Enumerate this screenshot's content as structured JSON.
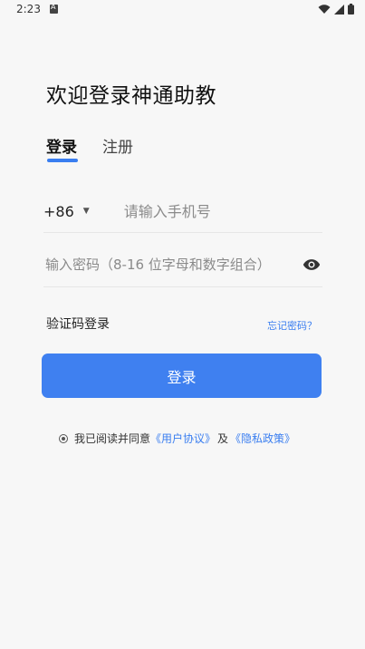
{
  "status_bar": {
    "time": "2:23"
  },
  "header": {
    "title": "欢迎登录神通助教"
  },
  "tabs": [
    {
      "label": "登录",
      "active": true
    },
    {
      "label": "注册",
      "active": false
    }
  ],
  "phone": {
    "country_code": "+86",
    "placeholder": "请输入手机号",
    "value": ""
  },
  "password": {
    "placeholder": "输入密码（8-16 位字母和数字组合）",
    "value": ""
  },
  "links": {
    "sms_login": "验证码登录",
    "forgot_password": "忘记密码？"
  },
  "login_button": {
    "label": "登录"
  },
  "agreement": {
    "prefix": "我已阅读并同意",
    "user_agreement": "《用户协议》",
    "and": "及",
    "privacy_policy": "《隐私政策》"
  },
  "colors": {
    "accent": "#3f80f0",
    "background": "#f7f7f7"
  },
  "icons": [
    "wifi-icon",
    "signal-icon",
    "battery-icon",
    "sim-icon",
    "dropdown-caret-icon",
    "eye-icon",
    "radio-icon"
  ]
}
